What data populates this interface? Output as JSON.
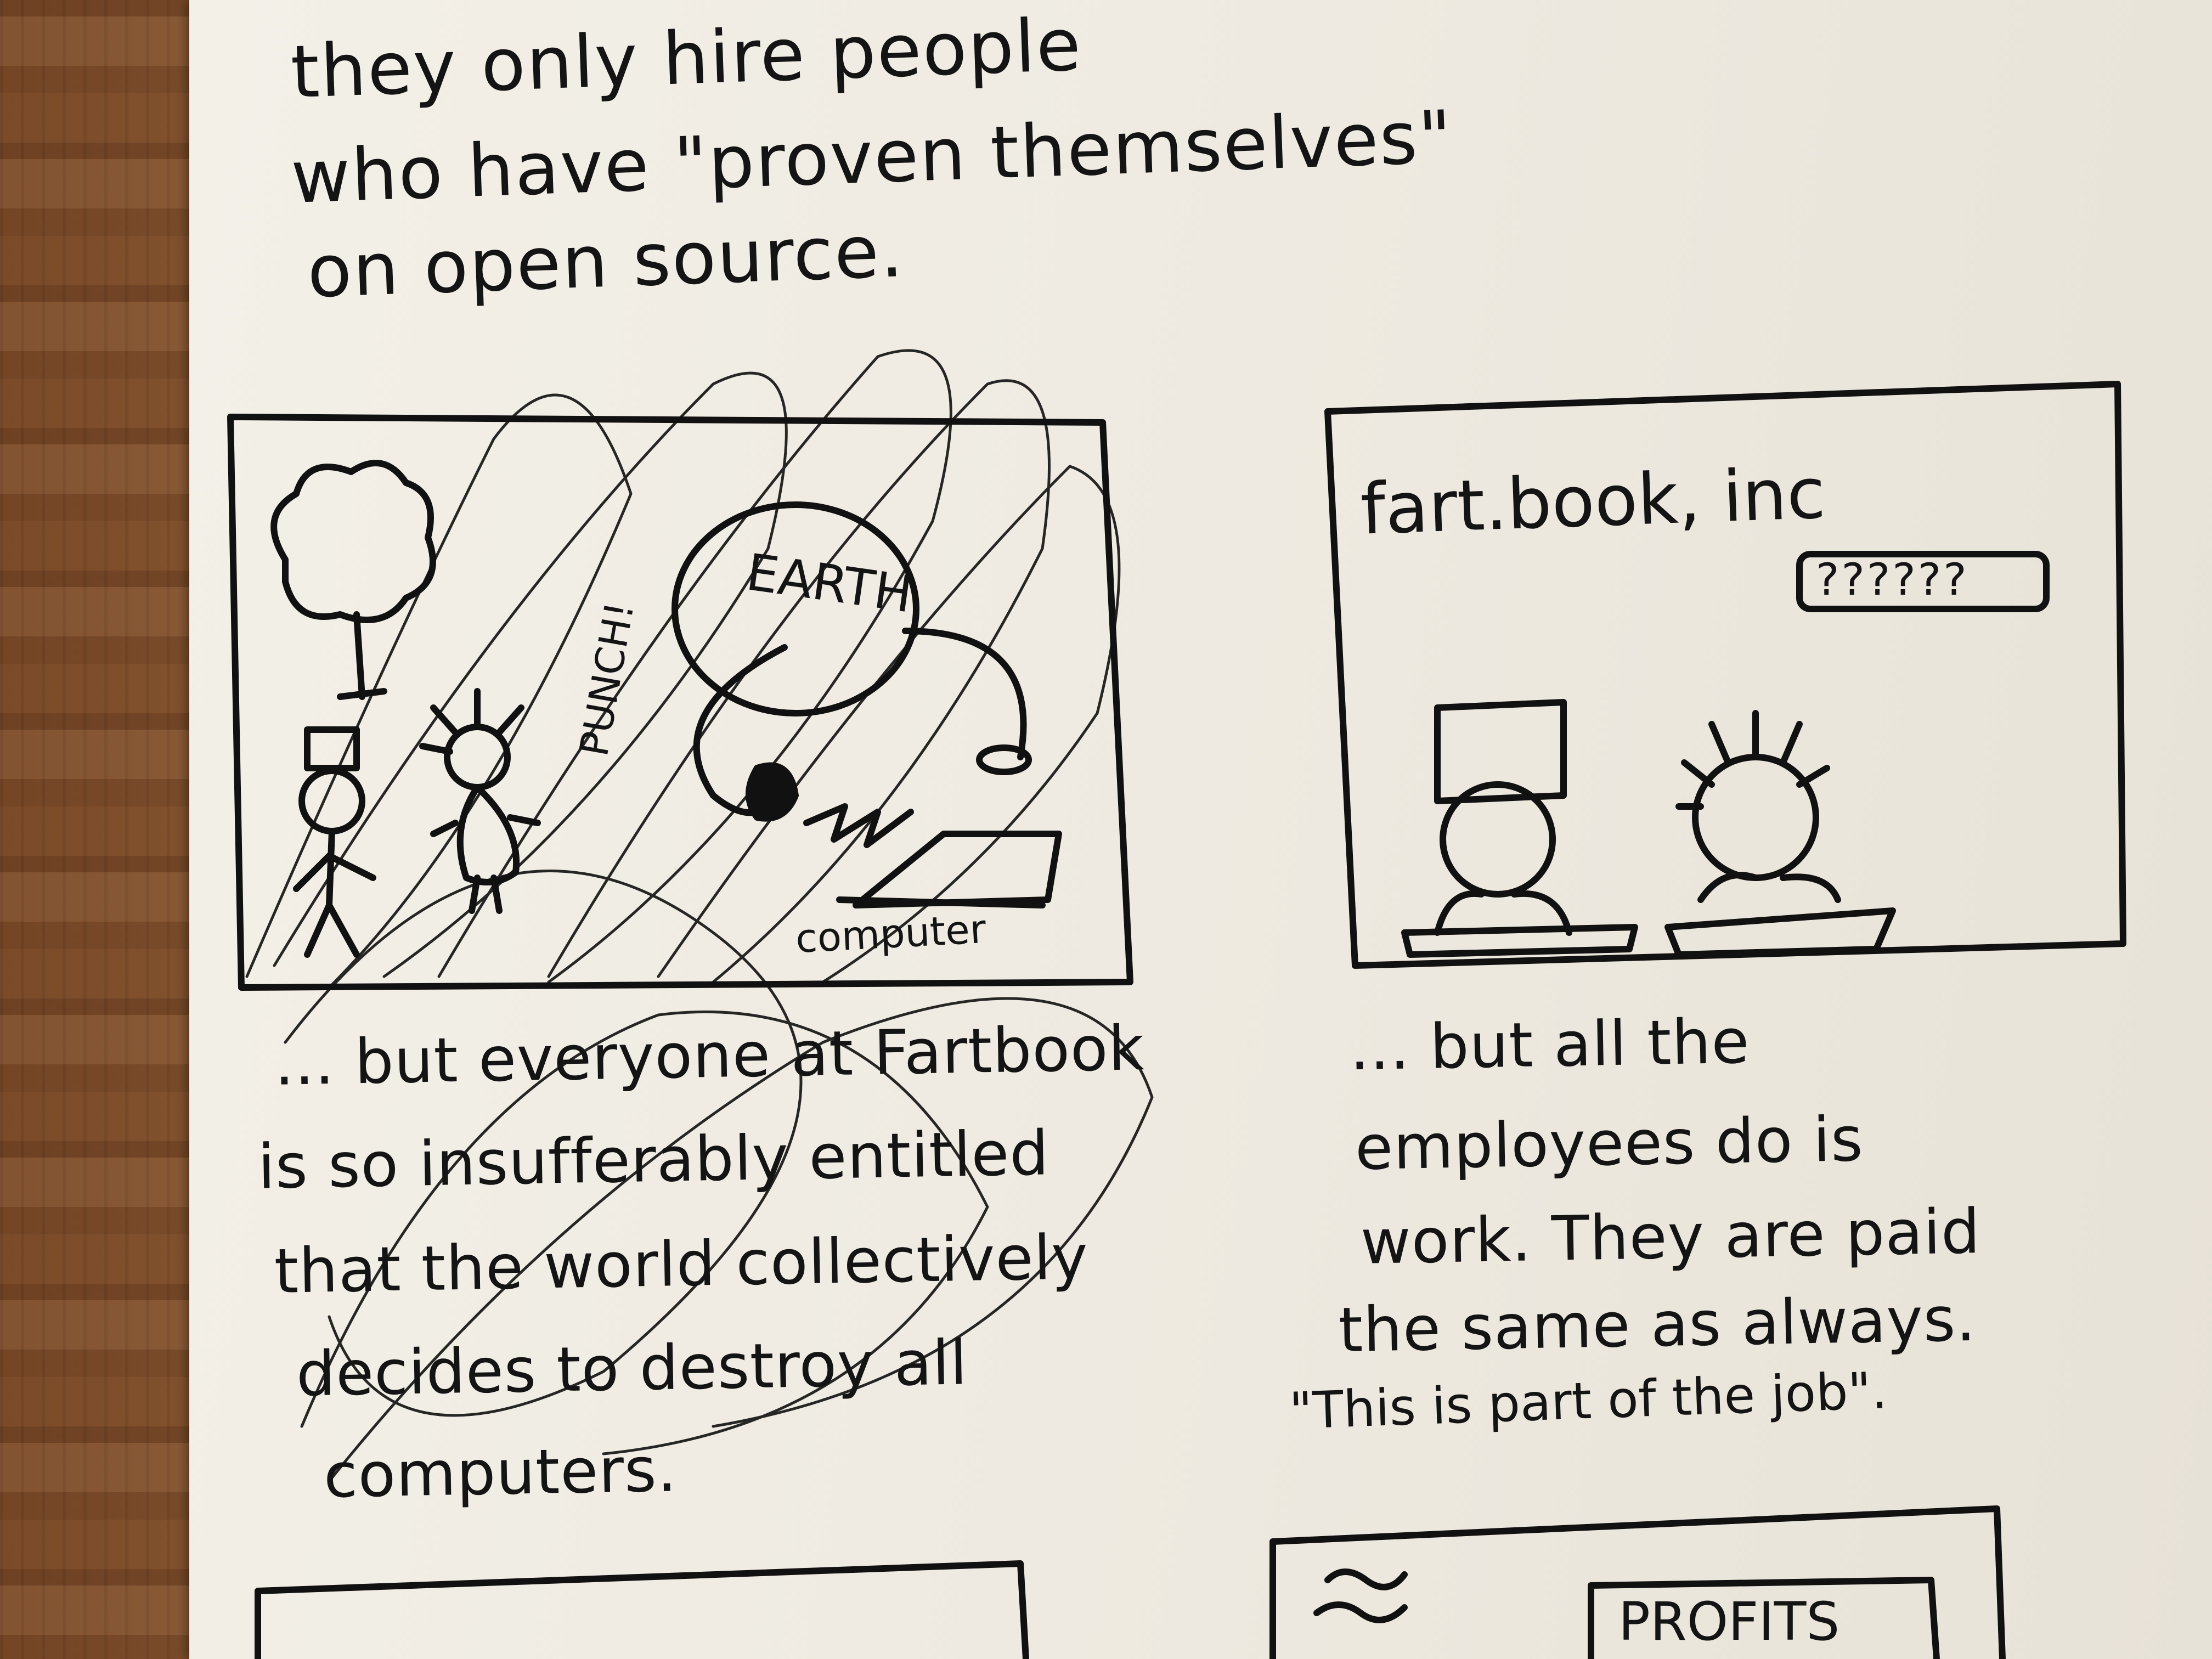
{
  "intro": {
    "lines": [
      "they only hire people",
      "who have \"proven themselves\"",
      "on open source."
    ]
  },
  "panel1": {
    "labels": {
      "earth": "EARTH",
      "punch": "PUNCH!",
      "computer": "computer"
    },
    "caption": [
      "... but everyone at Fartbook",
      "is so insufferably entitled",
      "that the world collectively",
      "decides to destroy all",
      "computers."
    ]
  },
  "panel2": {
    "sign": "fart.book, inc",
    "speech": "??????",
    "caption": [
      "... but all the",
      "employees do is",
      "work. They are paid",
      "the same as always.",
      "\"This is part of the job\"."
    ]
  },
  "panel4": {
    "label": "PROFITS"
  }
}
